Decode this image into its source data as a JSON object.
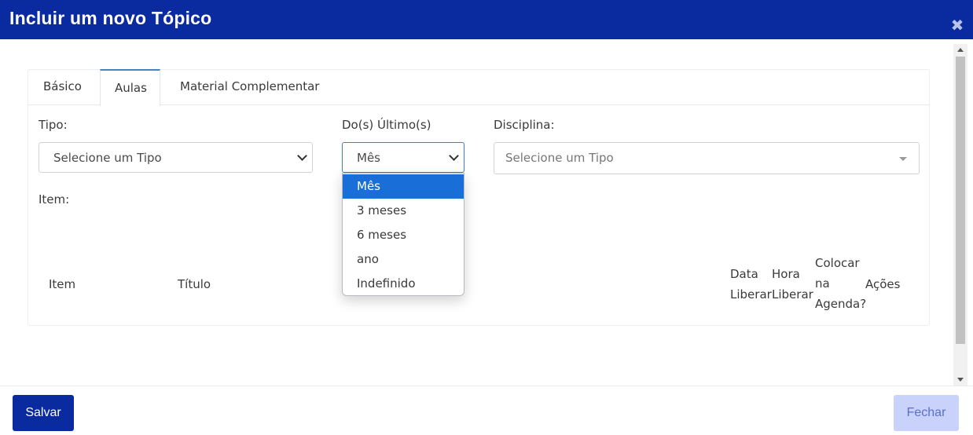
{
  "modal": {
    "title": "Incluir um novo Tópico",
    "close_icon": "close-icon"
  },
  "tabs": [
    {
      "label": "Básico",
      "active": false
    },
    {
      "label": "Aulas",
      "active": true
    },
    {
      "label": "Material Complementar",
      "active": false
    }
  ],
  "form": {
    "tipo": {
      "label": "Tipo:",
      "value": "Selecione um Tipo"
    },
    "ultimo": {
      "label": "Do(s) Último(s)",
      "value": "Mês",
      "options": [
        "Mês",
        "3 meses",
        "6 meses",
        "ano",
        "Indefinido"
      ],
      "selected_index": 0
    },
    "disciplina": {
      "label": "Disciplina:",
      "placeholder": "Selecione um Tipo"
    },
    "item_label": "Item:"
  },
  "table": {
    "headers": {
      "item": "Item",
      "titulo": "Título",
      "data_liberar": [
        "Data",
        "Liberar"
      ],
      "hora_liberar": [
        "Hora",
        "Liberar"
      ],
      "colocar_agenda": [
        "Colocar",
        "na",
        "Agenda?"
      ],
      "acoes": "Ações"
    }
  },
  "footer": {
    "salvar": "Salvar",
    "fechar": "Fechar"
  },
  "colors": {
    "primary": "#0a2a9f",
    "accent_tab": "#3f86c6",
    "selected_option": "#1a6ed8",
    "fechar_bg": "#c9d2fa"
  }
}
